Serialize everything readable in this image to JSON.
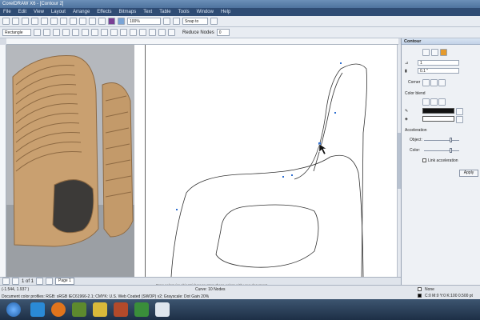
{
  "window": {
    "title": "CorelDRAW X6 - [Contour 2]"
  },
  "menu": [
    "File",
    "Edit",
    "View",
    "Layout",
    "Arrange",
    "Effects",
    "Bitmaps",
    "Text",
    "Table",
    "Tools",
    "Window",
    "Help"
  ],
  "toolbar": {
    "zoom": "100%",
    "snap": "Snap to",
    "shape_select": "Rectangle",
    "reduce_nodes_label": "Reduce Nodes",
    "reduce_nodes_value": "0"
  },
  "panel": {
    "title": "Contour",
    "steps": "1",
    "offset": "0.1 \"",
    "corners_label": "Corner",
    "color_blend_label": "Color blend",
    "acceleration_label": "Acceleration",
    "object_label": "Object:",
    "color_label": "Color:",
    "link_label": "Link acceleration",
    "apply": "Apply"
  },
  "pages": {
    "counter": "1 of 1",
    "tab": "Page 1"
  },
  "hint": "Drag colors (or objects) here to store these colors with your document",
  "status": {
    "coords": "(-1.544, 1.937 )",
    "object": "Curve: 10 Nodes",
    "profile": "Document color profiles: RGB: sRGB IEC61966-2.1; CMYK: U.S. Web Coated (SWOP) v2; Grayscale: Dot Gain 20%",
    "fill": "None",
    "outline": "C:0 M:0 Y:0 K:100  0.500 pt"
  },
  "colors": {
    "menubar": "#2f4c74",
    "accent": "#7a3f95"
  }
}
